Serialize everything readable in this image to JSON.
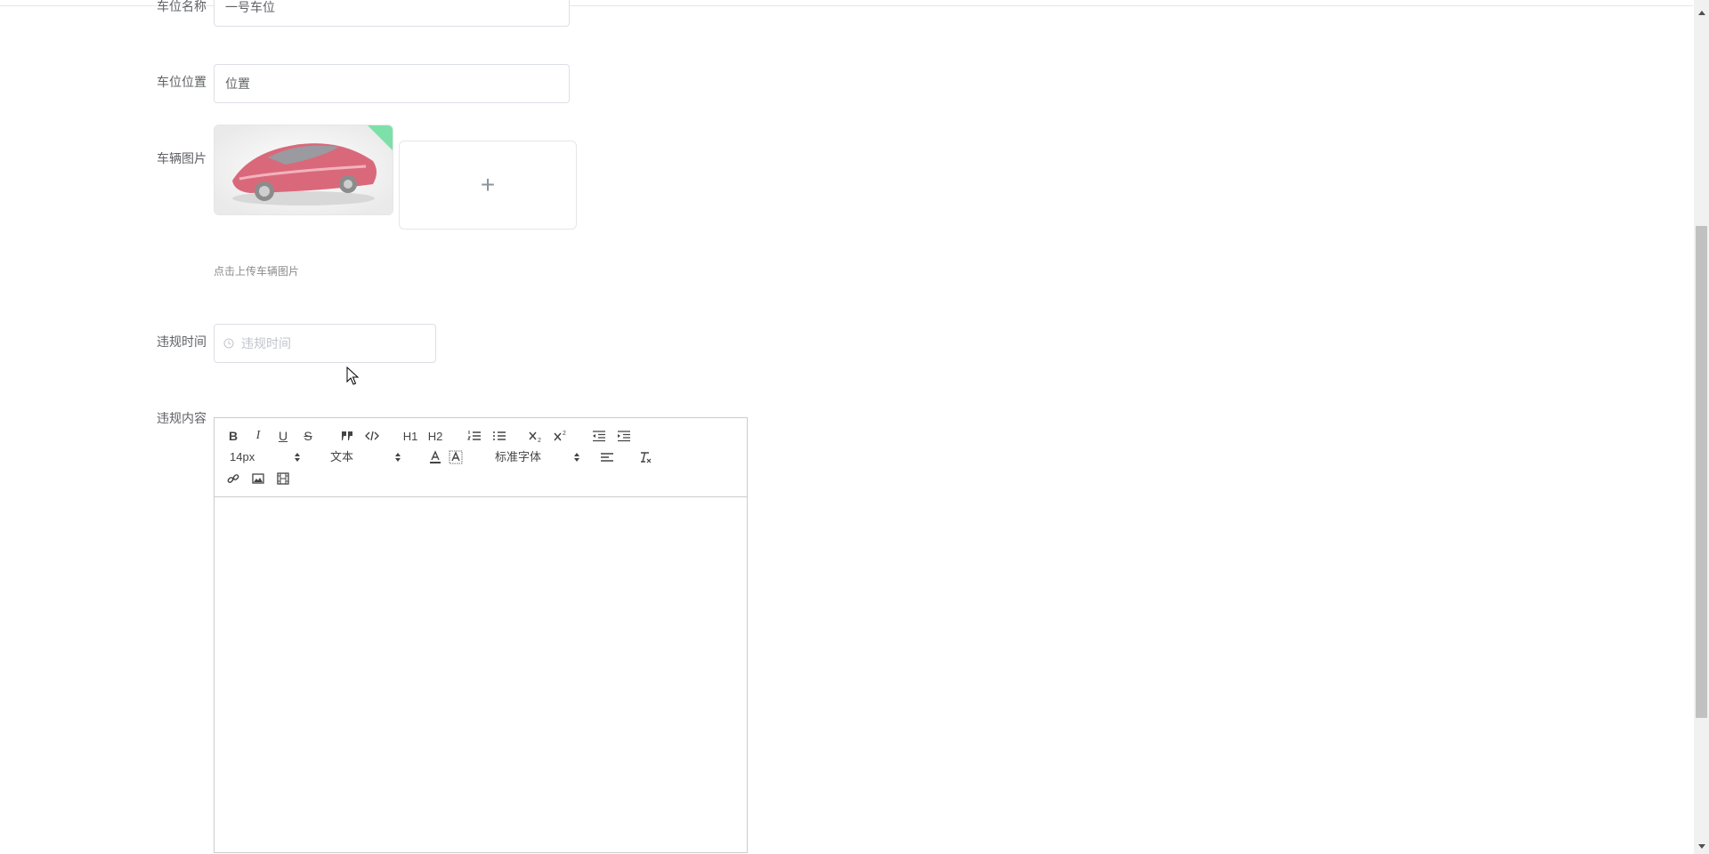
{
  "form": {
    "parking_name": {
      "label": "车位名称",
      "value": "一号车位"
    },
    "parking_location": {
      "label": "车位位置",
      "value": "位置"
    },
    "vehicle_image": {
      "label": "车辆图片",
      "upload_icon": "plus-icon",
      "tip": "点击上传车辆图片"
    },
    "violation_time": {
      "label": "违规时间",
      "placeholder": "违规时间",
      "icon": "clock-icon"
    },
    "violation_content": {
      "label": "违规内容"
    }
  },
  "editor": {
    "toolbar": {
      "bold": "B",
      "italic": "I",
      "underline": "U",
      "strike": "S",
      "h1": "H1",
      "h2": "H2",
      "sub": "x2",
      "sup": "x2",
      "size_select": "14px",
      "header_select": "文本",
      "font_select": "标准字体"
    }
  },
  "colors": {
    "accent_corner": "#7ce0a8",
    "border": "#dcdfe6"
  }
}
